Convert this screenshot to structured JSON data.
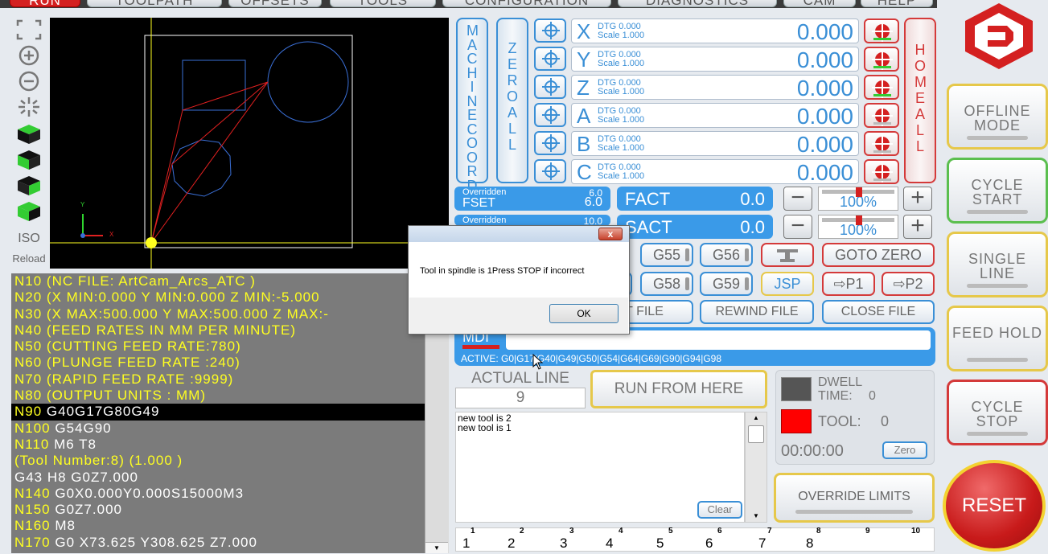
{
  "tabs": [
    "RUN",
    "TOOLPATH",
    "OFFSETS",
    "TOOLS",
    "CONFIGURATION",
    "DIAGNOSTICS",
    "CAM",
    "HELP"
  ],
  "left_toolbar": {
    "iso_label": "ISO",
    "reload_label": "Reload"
  },
  "viewport": {
    "axis_x": "X",
    "axis_y": "Y"
  },
  "gcode_lines": [
    "N10 (NC FILE: ArtCam_Arcs_ATC )",
    "N20 (X MIN:0.000  Y MIN:0.000  Z MIN:-5.000",
    "N30 (X MAX:500.000  Y MAX:500.000  Z MAX:-",
    "N40 (FEED RATES IN MM PER MINUTE)",
    "N50 (CUTTING FEED RATE:780)",
    "N60 (PLUNGE FEED RATE :240)",
    "N70 (RAPID FEED RATE  :9999)",
    "N80 (OUTPUT UNITS : MM)"
  ],
  "gcode_hl": {
    "n": "N90",
    "code": "G40G17G80G49"
  },
  "gcode_tail": [
    {
      "n": "N100",
      "code": "G54G90"
    },
    {
      "n": "N110",
      "code": "M6 T8"
    },
    {
      "n": "",
      "code": "(Tool Number:8) (1.000    )",
      "yellow": true
    },
    {
      "n": "",
      "code": "G43 H8 G0Z7.000",
      "white": true
    },
    {
      "n": "N140",
      "code": "G0X0.000Y0.000S15000M3"
    },
    {
      "n": "N150",
      "code": "G0Z7.000"
    },
    {
      "n": "N160",
      "code": "M8"
    },
    {
      "n": "N170",
      "code": "G0 X73.625 Y308.625 Z7.000"
    }
  ],
  "machine_coords": "MACHINE COORDS",
  "zero_all": "ZERO ALL",
  "home_all": "HOME ALL",
  "axes": [
    {
      "name": "X",
      "dtg": "DTG  0.000",
      "scale": "Scale 1.000",
      "value": "0.000"
    },
    {
      "name": "Y",
      "dtg": "DTG  0.000",
      "scale": "Scale 1.000",
      "value": "0.000"
    },
    {
      "name": "Z",
      "dtg": "DTG  0.000",
      "scale": "Scale 1.000",
      "value": "0.000"
    },
    {
      "name": "A",
      "dtg": "DTG  0.000",
      "scale": "Scale 1.000",
      "value": "0.000"
    },
    {
      "name": "B",
      "dtg": "DTG  0.000",
      "scale": "Scale 1.000",
      "value": "0.000"
    },
    {
      "name": "C",
      "dtg": "DTG  0.000",
      "scale": "Scale 1.000",
      "value": "0.000"
    }
  ],
  "feed": {
    "overridden_label": "Overridden",
    "overridden_value": "6.0",
    "fset_label": "FSET",
    "fset_value": "6.0",
    "fact_label": "FACT",
    "fact_value": "0.0",
    "percent": "100%"
  },
  "spindle": {
    "overridden_label": "Overridden",
    "overridden_value": "10.0",
    "sact_label": "SACT",
    "sact_value": "0.0",
    "percent": "100%"
  },
  "offset_buttons": [
    "G55",
    "G56",
    "G58",
    "G59"
  ],
  "goto_zero": "GOTO ZERO",
  "jsp": "JSP",
  "p1": "P1",
  "p2": "P2",
  "file_buttons": {
    "load": "T FILE",
    "rewind": "REWIND FILE",
    "close": "CLOSE FILE"
  },
  "mdi": {
    "label": "MDI",
    "active": "ACTIVE: G0|G17|G40|G49|G50|G54|G64|G69|G90|G94|G98"
  },
  "actual_line": {
    "label": "ACTUAL LINE",
    "value": "9"
  },
  "run_from_here": "RUN FROM HERE",
  "dwell": {
    "label1": "DWELL",
    "label2": "TIME:",
    "value": "0"
  },
  "tool": {
    "label": "TOOL:",
    "value": "0"
  },
  "timer": {
    "value": "00:00:00",
    "zero": "Zero"
  },
  "override_limits": "OVERRIDE LIMITS",
  "messages": [
    "new tool is   2",
    "new tool is   1"
  ],
  "clear": "Clear",
  "side": {
    "offline": "OFFLINE MODE",
    "cycle_start": "CYCLE START",
    "single_line": "SINGLE LINE",
    "feed_hold": "FEED HOLD",
    "cycle_stop": "CYCLE STOP",
    "reset": "RESET"
  },
  "ruler": {
    "top": [
      "1",
      "2",
      "3",
      "4",
      "5",
      "6",
      "7",
      "8",
      "9",
      "10"
    ],
    "bottom": [
      "1",
      "2",
      "3",
      "4",
      "5",
      "6",
      "7",
      "8"
    ]
  },
  "dialog": {
    "message": "Tool in spindle is 1Press STOP if incorrect",
    "ok": "OK",
    "close": "x"
  },
  "colors": {
    "accent": "#3a8fd6",
    "danger": "#d42020",
    "highlight": "#ffff20",
    "panel": "#3a9ae8"
  }
}
